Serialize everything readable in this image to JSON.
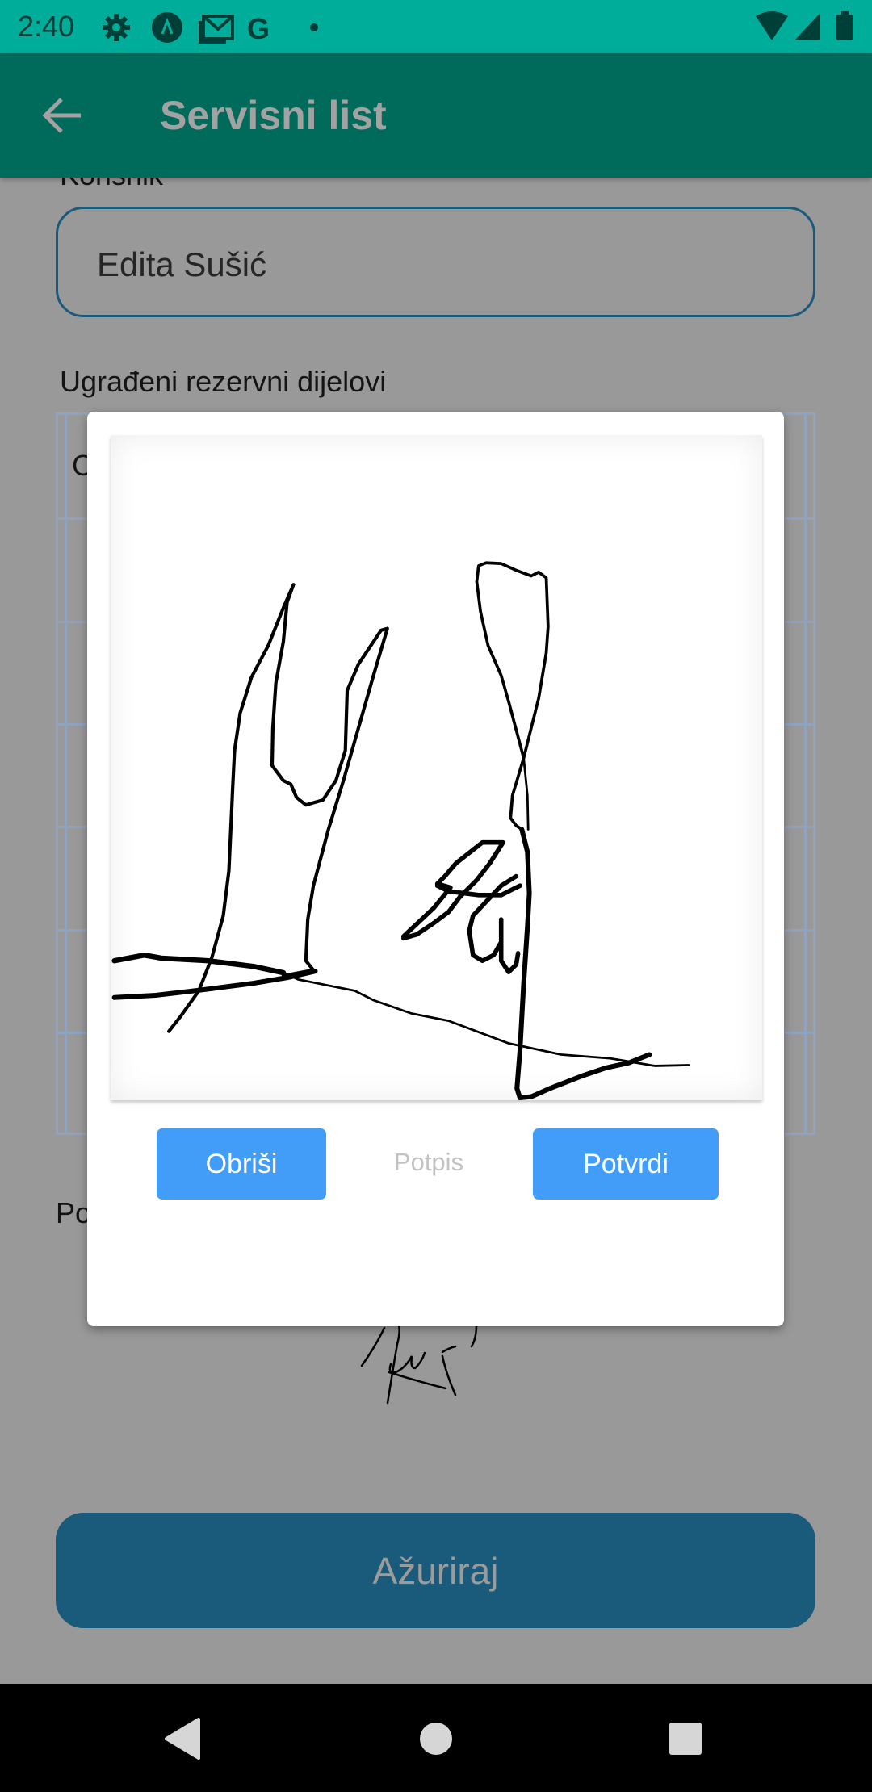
{
  "status_bar": {
    "time": "2:40",
    "notification_icons": [
      "gear-icon",
      "expo-icon",
      "gmail-icon",
      "google-icon",
      "dot-icon"
    ],
    "system_icons": [
      "wifi-icon",
      "signal-icon",
      "battery-icon"
    ]
  },
  "app_bar": {
    "title": "Servisni list",
    "back_icon": "arrow-left-icon"
  },
  "form": {
    "customer_label": "Korisnik",
    "customer_value": "Edita Sušić",
    "parts_label": "Ugrađeni rezervni dijelovi",
    "parts_first_cell_partial": "C",
    "signature_label_partial": "Po",
    "update_button": "Ažuriraj"
  },
  "dialog": {
    "clear_button": "Obriši",
    "title": "Potpis",
    "confirm_button": "Potvrdi"
  },
  "colors": {
    "status_bar": "#00ad9b",
    "app_bar": "#006a5b",
    "dialog_button": "#419df8",
    "update_button": "#1a5a7a"
  }
}
